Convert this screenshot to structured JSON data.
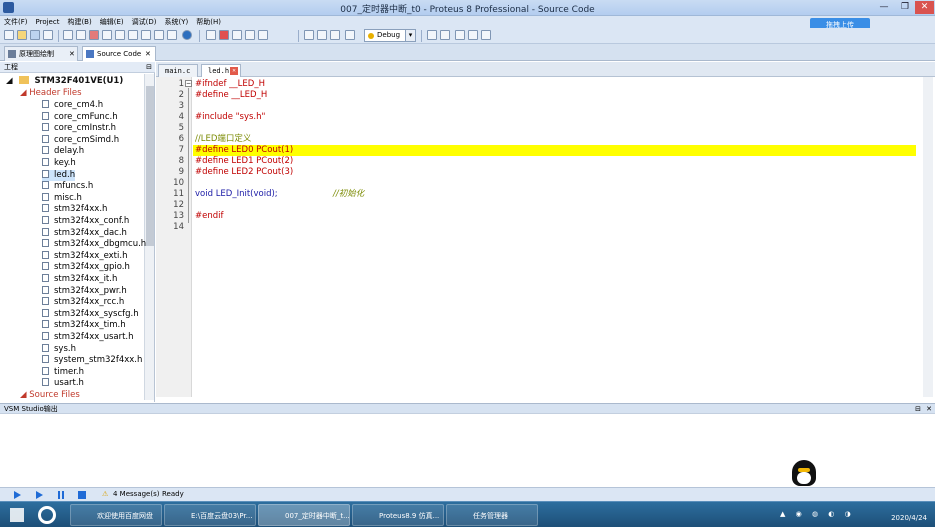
{
  "window": {
    "title": "007_定时器中断_t0 - Proteus 8 Professional - Source Code",
    "controls": [
      "—",
      "❐",
      "✕"
    ]
  },
  "menu": [
    "文件(F)",
    "Project",
    "构建(B)",
    "编辑(E)",
    "调试(D)",
    "系统(Y)",
    "帮助(H)"
  ],
  "toolbar": {
    "debug_select": "Debug",
    "upload_button": "拖拽上传"
  },
  "doc_tabs": [
    {
      "label": "原理图绘制",
      "icon": "schematic-icon"
    },
    {
      "label": "Source Code",
      "icon": "source-code-icon",
      "active": true
    }
  ],
  "project": {
    "header": "工程",
    "root": "STM32F401VE(U1)",
    "group_header_files": "Header Files",
    "files": [
      "core_cm4.h",
      "core_cmFunc.h",
      "core_cmInstr.h",
      "core_cmSimd.h",
      "delay.h",
      "key.h",
      "led.h",
      "mfuncs.h",
      "misc.h",
      "stm32f4xx.h",
      "stm32f4xx_conf.h",
      "stm32f4xx_dac.h",
      "stm32f4xx_dbgmcu.h",
      "stm32f4xx_exti.h",
      "stm32f4xx_gpio.h",
      "stm32f4xx_it.h",
      "stm32f4xx_pwr.h",
      "stm32f4xx_rcc.h",
      "stm32f4xx_syscfg.h",
      "stm32f4xx_tim.h",
      "stm32f4xx_usart.h",
      "sys.h",
      "system_stm32f4xx.h",
      "timer.h",
      "usart.h"
    ],
    "selected_file": "led.h",
    "group_source_files": "Source Files"
  },
  "editor": {
    "tabs": [
      {
        "label": "main.c"
      },
      {
        "label": "led.h",
        "active": true
      }
    ],
    "lines": [
      {
        "n": "1",
        "text": "#ifndef __LED_H",
        "color": "#c00000"
      },
      {
        "n": "2",
        "text": "#define __LED_H",
        "color": "#c00000"
      },
      {
        "n": "3",
        "text": "",
        "color": "#000000"
      },
      {
        "n": "4",
        "text": "#include \"sys.h\"",
        "color": "#c00000"
      },
      {
        "n": "5",
        "text": "",
        "color": "#000000"
      },
      {
        "n": "6",
        "text": "//LED端口定义",
        "color": "#7a8a00"
      },
      {
        "n": "7",
        "text": "#define LED0 PCout(1)",
        "color": "#c00000",
        "highlight": true
      },
      {
        "n": "8",
        "text": "#define LED1 PCout(2)",
        "color": "#c00000"
      },
      {
        "n": "9",
        "text": "#define LED2 PCout(3)",
        "color": "#c00000"
      },
      {
        "n": "10",
        "text": "",
        "color": "#000000"
      },
      {
        "n": "11",
        "text": "void LED_Init(void);",
        "color": "#1a1aa6"
      },
      {
        "n": "12",
        "text": "",
        "color": "#000000"
      },
      {
        "n": "13",
        "text": "#endif",
        "color": "#c00000"
      },
      {
        "n": "14",
        "text": "",
        "color": "#000000"
      }
    ],
    "comment_line11": "//初始化"
  },
  "output": {
    "header": "VSM Studio输出"
  },
  "status": {
    "messages": "4 Message(s)",
    "state": "Ready"
  },
  "taskbar": {
    "items": [
      {
        "label": "欢迎使用百度网盘",
        "color": "#2f7de1"
      },
      {
        "label": "E:\\百度云盘03\\Pr...",
        "color": "#e8b84a"
      },
      {
        "label": "007_定时器中断_t...",
        "color": "#5d87c7"
      },
      {
        "label": "Proteus8.9 仿真...",
        "color": "#4a7fd0"
      },
      {
        "label": "任务管理器",
        "color": "#6a9a5a"
      }
    ],
    "date": "2020/4/24"
  }
}
